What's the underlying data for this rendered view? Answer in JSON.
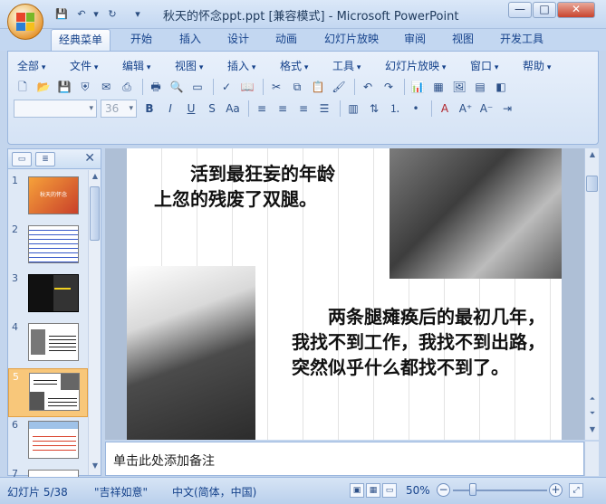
{
  "window": {
    "title": "秋天的怀念ppt.ppt [兼容模式] - Microsoft PowerPoint",
    "minimize": "—",
    "restore": "□",
    "close": "✕"
  },
  "qat": {
    "save_icon": "save-icon",
    "undo_icon": "undo-icon",
    "redo_icon": "redo-icon",
    "customize_icon": "dropdown-icon"
  },
  "tabs": [
    "经典菜单",
    "开始",
    "插入",
    "设计",
    "动画",
    "幻灯片放映",
    "审阅",
    "视图",
    "开发工具"
  ],
  "menus": [
    "全部",
    "文件",
    "编辑",
    "视图",
    "插入",
    "格式",
    "工具",
    "幻灯片放映",
    "窗口",
    "帮助"
  ],
  "font_combo": {
    "font": "",
    "size": "36"
  },
  "left_pane": {
    "slides": [
      {
        "num": "1",
        "title": "秋天的怀念"
      },
      {
        "num": "2",
        "title": ""
      },
      {
        "num": "3",
        "title": ""
      },
      {
        "num": "4",
        "title": ""
      },
      {
        "num": "5",
        "title": ""
      },
      {
        "num": "6",
        "title": ""
      },
      {
        "num": "7",
        "title": ""
      }
    ]
  },
  "slide": {
    "text1": "活到最狂妄的年龄上忽的残废了双腿。",
    "text2": "两条腿瘫痪后的最初几年，我找不到工作，我找不到出路，突然似乎什么都找不到了。"
  },
  "notes": {
    "placeholder": "单击此处添加备注"
  },
  "status": {
    "slide_count": "幻灯片 5/38",
    "theme": "\"吉祥如意\"",
    "language": "中文(简体，中国)",
    "zoom": "50%",
    "zoom_value": 0.5
  },
  "colors": {
    "accent": "#15428b",
    "selected_slide": "#f8c77a"
  }
}
